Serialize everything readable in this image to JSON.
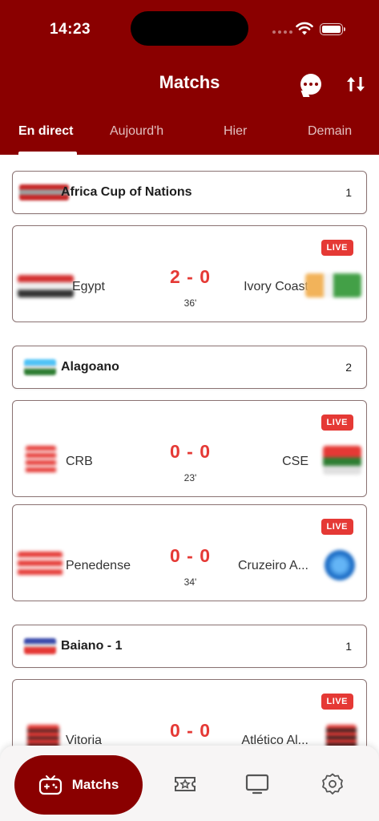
{
  "status_bar": {
    "time": "14:23"
  },
  "header": {
    "title": "Matchs",
    "chat_icon": "chat-bubble-icon",
    "sort_icon": "sort-arrows-icon"
  },
  "tabs": [
    {
      "label": "En direct",
      "active": true
    },
    {
      "label": "Aujourd'h",
      "active": false
    },
    {
      "label": "Hier",
      "active": false
    },
    {
      "label": "Demain",
      "active": false
    }
  ],
  "leagues": [
    {
      "name": "Africa Cup of Nations",
      "count": "1",
      "matches": [
        {
          "home": "Egypt",
          "away": "Ivory Coast",
          "score": "2 - 0",
          "minute": "36'",
          "status": "LIVE"
        }
      ]
    },
    {
      "name": "Alagoano",
      "count": "2",
      "matches": [
        {
          "home": "CRB",
          "away": "CSE",
          "score": "0 - 0",
          "minute": "23'",
          "status": "LIVE"
        },
        {
          "home": "Penedense",
          "away": "Cruzeiro A...",
          "score": "0 - 0",
          "minute": "34'",
          "status": "LIVE"
        }
      ]
    },
    {
      "name": "Baiano - 1",
      "count": "1",
      "matches": [
        {
          "home": "Vitoria",
          "away": "Atlético Al...",
          "score": "0 - 0",
          "minute": "",
          "status": "LIVE"
        }
      ]
    }
  ],
  "bottom_nav": {
    "active_label": "Matchs",
    "items": [
      "gamepad-icon",
      "ticket-icon",
      "tv-icon",
      "settings-icon"
    ]
  },
  "colors": {
    "primary": "#8a0000",
    "live": "#e53935"
  }
}
